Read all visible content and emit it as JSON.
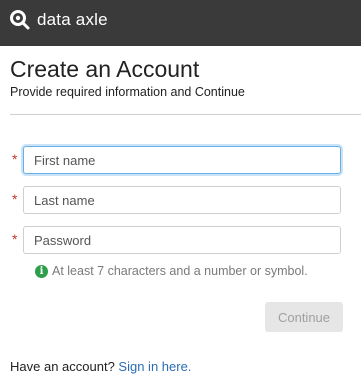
{
  "header": {
    "brand": "data axle",
    "background": "#3a3a3a"
  },
  "page": {
    "title": "Create an Account",
    "subtitle": "Provide required information and Continue"
  },
  "form": {
    "required_marker": "*",
    "first_name": {
      "value": "",
      "placeholder": "First name",
      "focused": true
    },
    "last_name": {
      "value": "",
      "placeholder": "Last name"
    },
    "password": {
      "value": "",
      "placeholder": "Password"
    },
    "password_hint": "At least 7 characters and a number or symbol.",
    "hint_icon": "info-icon",
    "hint_icon_glyph": "i",
    "continue_label": "Continue",
    "continue_enabled": false
  },
  "footer": {
    "prompt": "Have an account?",
    "link_text": "Sign in here."
  },
  "colors": {
    "required": "#c0392b",
    "hint_icon": "#2e9e4a",
    "link": "#2a6db5",
    "focus": "#66afe9"
  }
}
